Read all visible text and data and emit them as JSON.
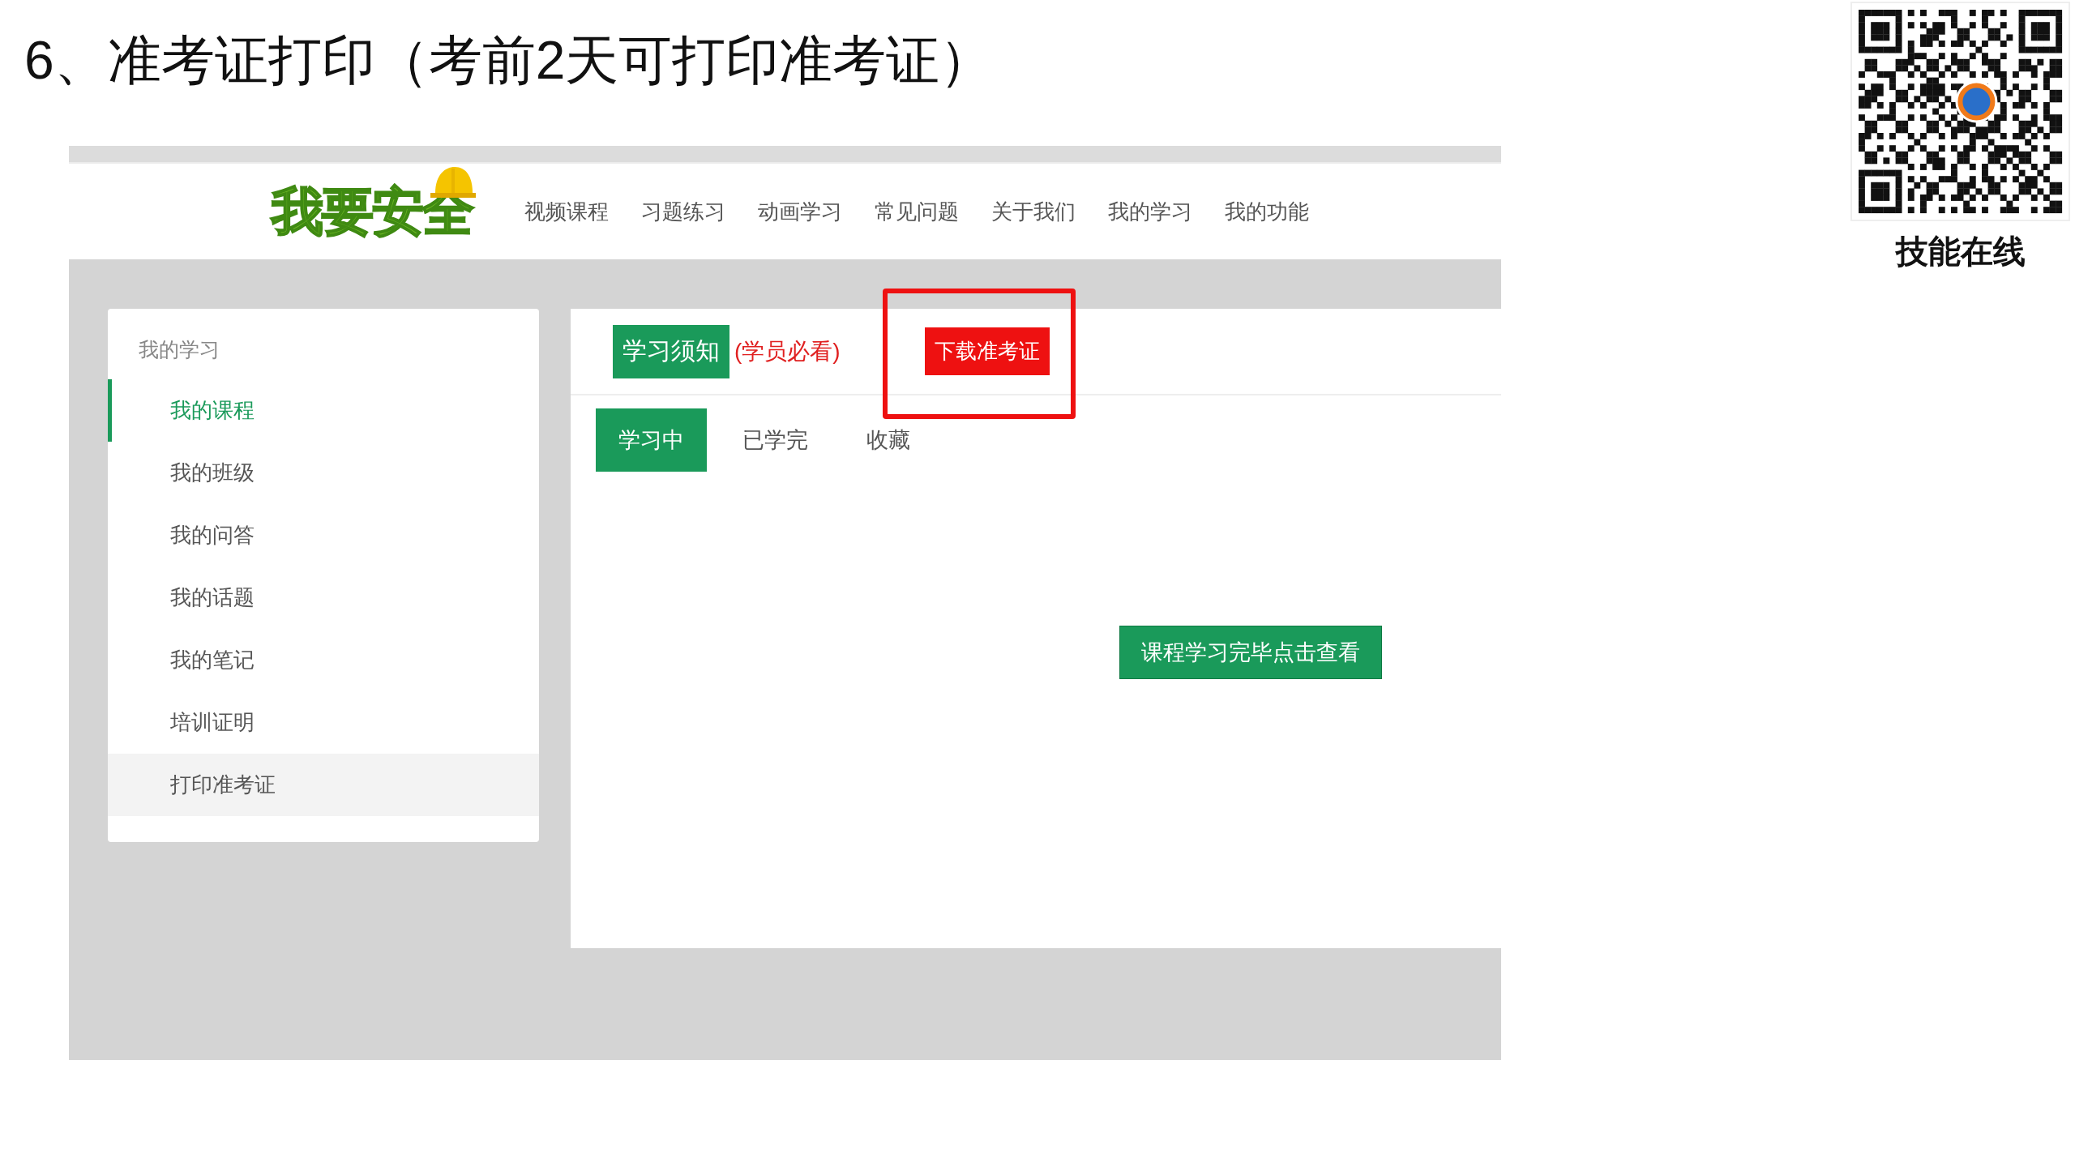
{
  "slide_title": "6、准考证打印（考前2天可打印准考证）",
  "qr_caption": "技能在线",
  "site": {
    "logo": "我要安全",
    "nav": [
      "视频课程",
      "习题练习",
      "动画学习",
      "常见问题",
      "关于我们",
      "我的学习",
      "我的功能"
    ],
    "sidebar": {
      "heading": "我的学习",
      "items": [
        {
          "label": "我的课程",
          "selected": true,
          "hovered": false
        },
        {
          "label": "我的班级",
          "selected": false,
          "hovered": false
        },
        {
          "label": "我的问答",
          "selected": false,
          "hovered": false
        },
        {
          "label": "我的话题",
          "selected": false,
          "hovered": false
        },
        {
          "label": "我的笔记",
          "selected": false,
          "hovered": false
        },
        {
          "label": "培训证明",
          "selected": false,
          "hovered": false
        },
        {
          "label": "打印准考证",
          "selected": false,
          "hovered": true
        }
      ]
    },
    "notice_button": "学习须知",
    "notice_note": "(学员必看)",
    "download_button": "下载准考证",
    "download_marked": true,
    "tabs": [
      {
        "label": "学习中",
        "selected": true
      },
      {
        "label": "已学完",
        "selected": false
      },
      {
        "label": "收藏",
        "selected": false
      }
    ],
    "finish_button": "课程学习完毕点击查看"
  }
}
